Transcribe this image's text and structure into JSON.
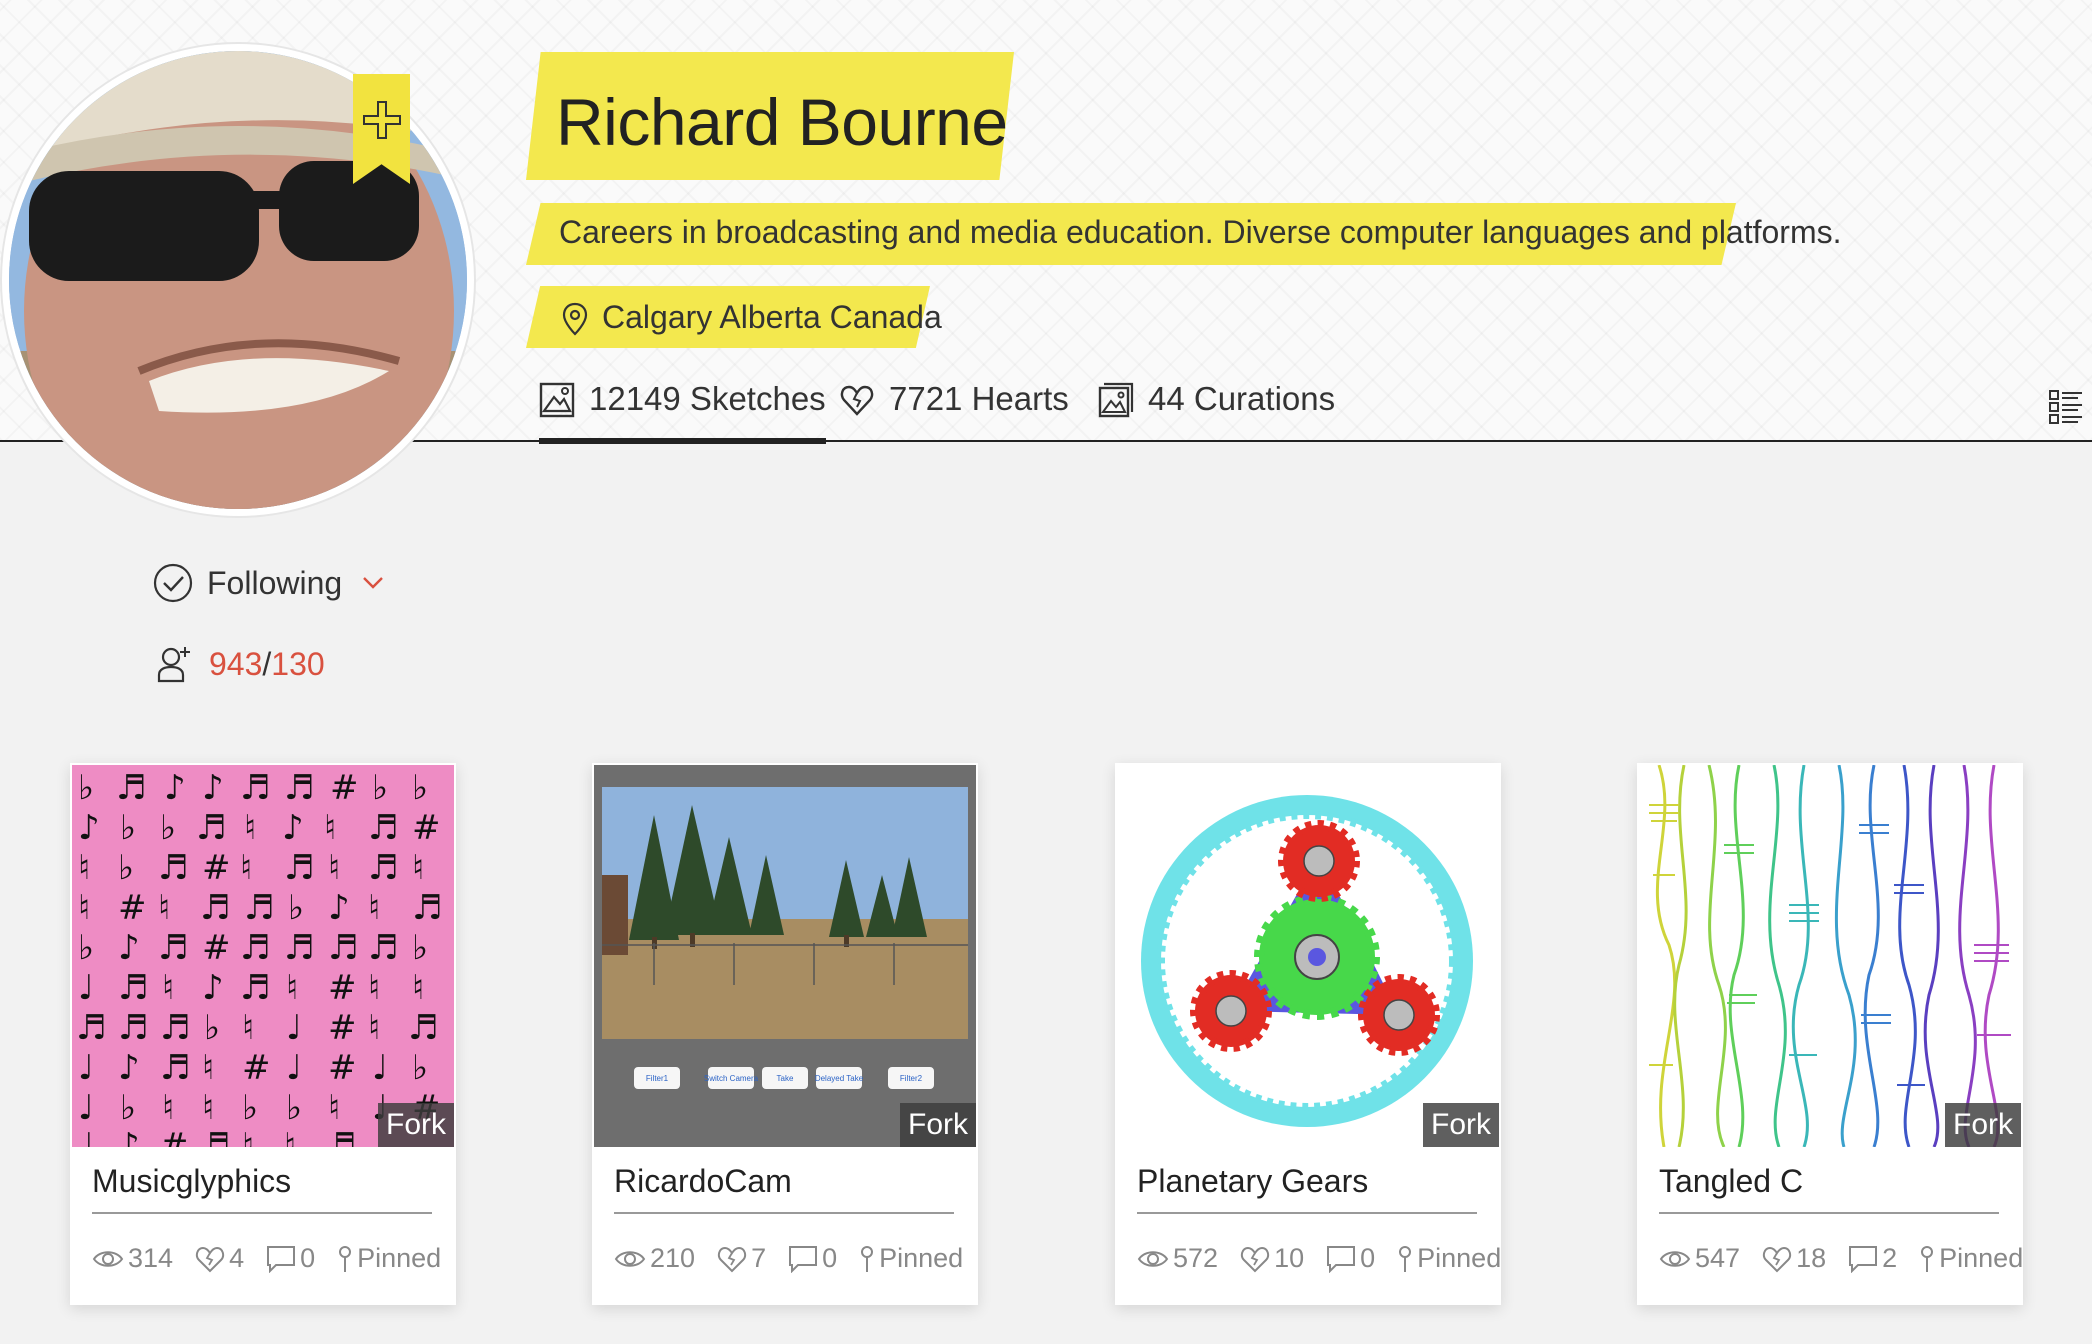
{
  "profile": {
    "name": "Richard Bourne",
    "bio": "Careers in broadcasting and media education. Diverse computer languages and platforms.",
    "location": "Calgary Alberta Canada"
  },
  "tabs": [
    {
      "label": "12149 Sketches",
      "icon": "sketch-icon",
      "active": true
    },
    {
      "label": "7721 Hearts",
      "icon": "heart-icon",
      "active": false
    },
    {
      "label": "44 Curations",
      "icon": "curation-icon",
      "active": false
    }
  ],
  "follow": {
    "label": "Following",
    "followers": "943",
    "separator": "/",
    "following": "130"
  },
  "colors": {
    "highlight": "#f3e84e",
    "accent_red": "#d9513f"
  },
  "cards": [
    {
      "title": "Musicglyphics",
      "fork": "Fork",
      "views": "314",
      "hearts": "4",
      "comments": "0",
      "pinned": "Pinned"
    },
    {
      "title": "RicardoCam",
      "fork": "Fork",
      "views": "210",
      "hearts": "7",
      "comments": "0",
      "pinned": "Pinned",
      "buttons": [
        "Filter1",
        "Switch Camera",
        "Take",
        "Delayed Take",
        "Filter2"
      ]
    },
    {
      "title": "Planetary Gears",
      "fork": "Fork",
      "views": "572",
      "hearts": "10",
      "comments": "0",
      "pinned": "Pinned"
    },
    {
      "title": "Tangled C",
      "fork": "Fork",
      "views": "547",
      "hearts": "18",
      "comments": "2",
      "pinned": "Pinned"
    }
  ]
}
